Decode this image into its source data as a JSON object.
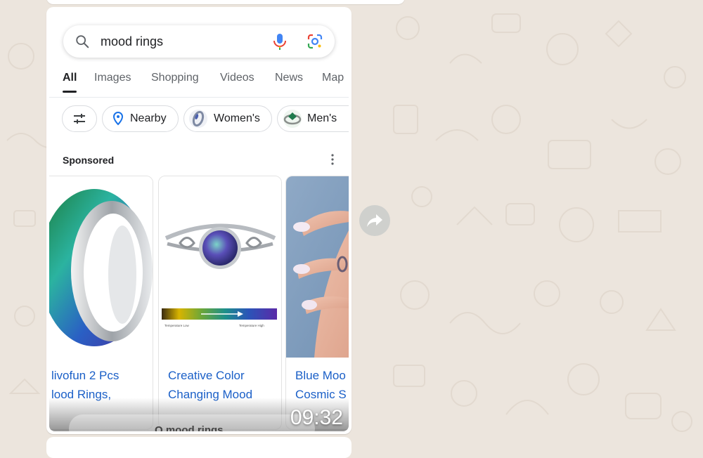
{
  "search": {
    "query": "mood rings"
  },
  "tabs": [
    {
      "label": "All",
      "active": true
    },
    {
      "label": "Images"
    },
    {
      "label": "Shopping"
    },
    {
      "label": "Videos"
    },
    {
      "label": "News"
    },
    {
      "label": "Map"
    }
  ],
  "chips": [
    {
      "icon": "tune-icon",
      "label": ""
    },
    {
      "icon": "location-pin-icon",
      "label": "Nearby"
    },
    {
      "icon": "ring-thumbnail-icon",
      "label": "Women's"
    },
    {
      "icon": "ring-thumbnail-icon",
      "label": "Men's"
    }
  ],
  "sponsored_label": "Sponsored",
  "products": [
    {
      "title_line1": "livofun 2 Pcs",
      "title_line2": "lood Rings,"
    },
    {
      "title_line1": "Creative Color",
      "title_line2": "Changing Mood",
      "scale_left": "Temperature Low",
      "scale_right": "Temperature High"
    },
    {
      "title_line1": "Blue Moo",
      "title_line2": "Cosmic S"
    }
  ],
  "bottom_bar": {
    "query_partial": "Q mood rings"
  },
  "message": {
    "time": "09:32"
  },
  "colors": {
    "wallpaper": "#ece5dd",
    "link_blue": "#1a5fc7",
    "google_blue": "#4285f4"
  }
}
